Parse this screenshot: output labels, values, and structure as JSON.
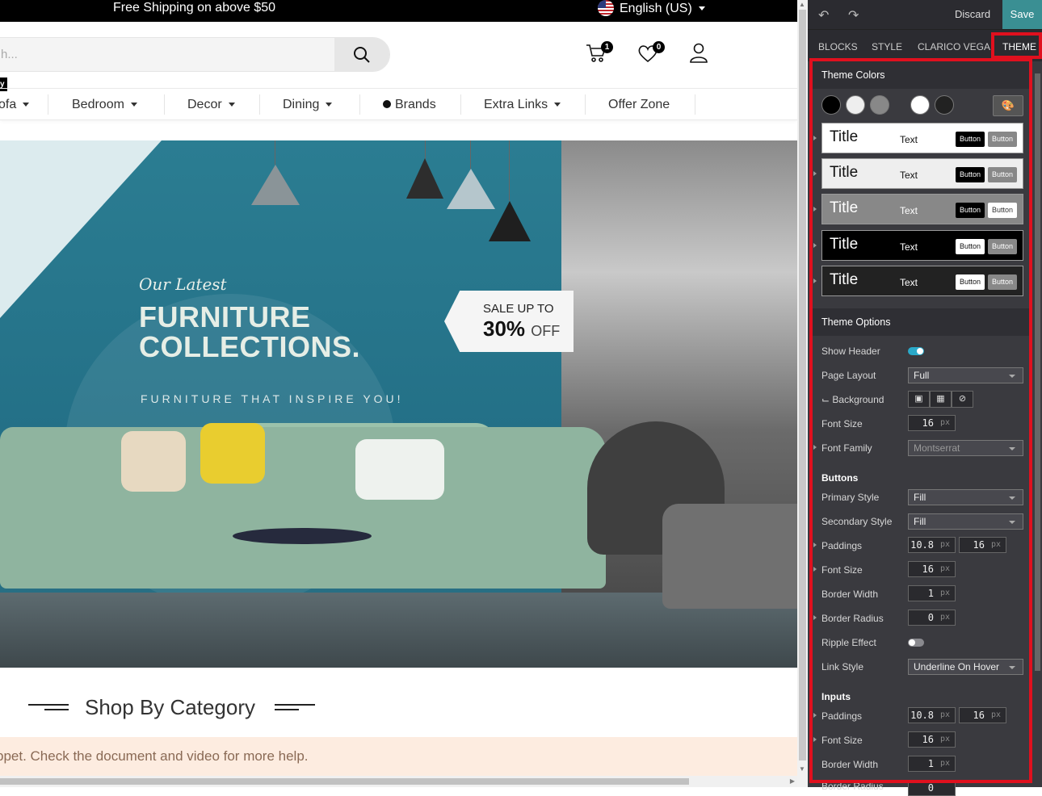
{
  "site": {
    "topbar": {
      "shipping": "Free Shipping on above $50",
      "language": "English (US)"
    },
    "search": {
      "placeholder": "h..."
    },
    "header": {
      "cart_count": "1",
      "wishlist_count": "0"
    },
    "tiny_label": "y",
    "menu": [
      {
        "label": "ofa",
        "caret": true
      },
      {
        "label": "Bedroom",
        "caret": true
      },
      {
        "label": "Decor",
        "caret": true
      },
      {
        "label": "Dining",
        "caret": true
      },
      {
        "label": "Brands",
        "caret": false
      },
      {
        "label": "Extra Links",
        "caret": true
      },
      {
        "label": "Offer Zone",
        "caret": false
      }
    ],
    "banner": {
      "eyebrow": "Our Latest",
      "title_line1": "FURNITURE",
      "title_line2": "COLLECTIONS.",
      "tagline": "FURNITURE THAT INSPIRE YOU!",
      "sale_line1": "SALE UP TO",
      "sale_pct": "30%",
      "sale_off": "OFF"
    },
    "category_heading": "Shop By Category",
    "notice": "ppet. Check the document and video for more help."
  },
  "editor": {
    "toolbar": {
      "discard": "Discard",
      "save": "Save"
    },
    "tabs": [
      "BLOCKS",
      "STYLE",
      "CLARICO VEGA",
      "THEME"
    ],
    "active_tab": "THEME",
    "theme_colors": {
      "heading": "Theme Colors",
      "swatches": [
        "#000000",
        "#eeeeee",
        "#888888",
        "#ffffff",
        "#222222"
      ],
      "presets": [
        {
          "title": "Title",
          "text": "Text",
          "button1": "Button",
          "button2": "Button"
        },
        {
          "title": "Title",
          "text": "Text",
          "button1": "Button",
          "button2": "Button"
        },
        {
          "title": "Title",
          "text": "Text",
          "button1": "Button",
          "button2": "Button"
        },
        {
          "title": "Title",
          "text": "Text",
          "button1": "Button",
          "button2": "Button"
        },
        {
          "title": "Title",
          "text": "Text",
          "button1": "Button",
          "button2": "Button"
        }
      ]
    },
    "theme_options": {
      "heading": "Theme Options",
      "show_header": "Show Header",
      "page_layout": {
        "label": "Page Layout",
        "value": "Full"
      },
      "background": "⌙ Background",
      "font_size": {
        "label": "Font Size",
        "value": "16",
        "unit": "px"
      },
      "font_family": {
        "label": "Font Family",
        "value": "Montserrat"
      },
      "buttons_heading": "Buttons",
      "primary_style": {
        "label": "Primary Style",
        "value": "Fill"
      },
      "secondary_style": {
        "label": "Secondary Style",
        "value": "Fill"
      },
      "btn_paddings": {
        "label": "Paddings",
        "v1": "10.8",
        "v2": "16",
        "unit": "px"
      },
      "btn_font_size": {
        "label": "Font Size",
        "value": "16",
        "unit": "px"
      },
      "btn_border_width": {
        "label": "Border Width",
        "value": "1",
        "unit": "px"
      },
      "btn_border_radius": {
        "label": "Border Radius",
        "value": "0",
        "unit": "px"
      },
      "ripple_effect": "Ripple Effect",
      "link_style": {
        "label": "Link Style",
        "value": "Underline On Hover"
      },
      "inputs_heading": "Inputs",
      "in_paddings": {
        "label": "Paddings",
        "v1": "10.8",
        "v2": "16",
        "unit": "px"
      },
      "in_font_size": {
        "label": "Font Size",
        "value": "16",
        "unit": "px"
      },
      "in_border_width": {
        "label": "Border Width",
        "value": "1",
        "unit": "px"
      },
      "in_border_radius": {
        "label": "Border Radius",
        "value": "0"
      }
    }
  },
  "colors": {
    "accent": "#3a8f93",
    "highlight": "#e0101e",
    "panel_bg": "#3a3a3f",
    "toggle_on": "#2aa9c9"
  }
}
